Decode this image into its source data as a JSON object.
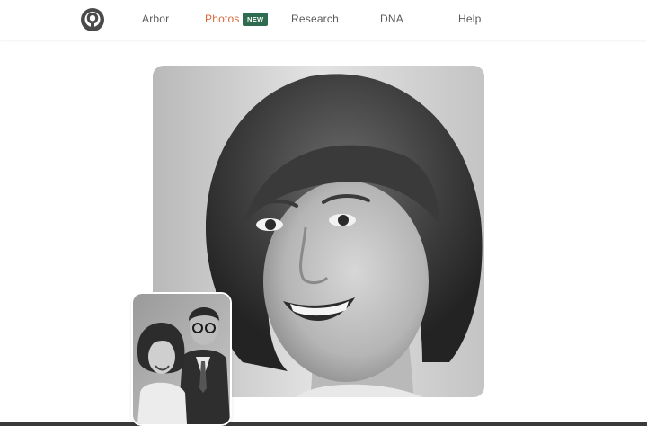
{
  "nav": {
    "items": [
      {
        "label": "Arbor"
      },
      {
        "label": "Photos",
        "active": true
      },
      {
        "label": "Research"
      },
      {
        "label": "DNA"
      },
      {
        "label": "Help"
      }
    ],
    "badge": "NEW"
  },
  "colors": {
    "active_nav": "#d6683a",
    "badge_bg": "#2f6b4f",
    "nav_text": "#5a5a5a"
  },
  "icons": {
    "logo": "tree-logo-icon"
  },
  "images": {
    "main": "restored-black-and-white-portrait-of-smiling-woman",
    "thumbnail": "original-black-and-white-couple-photo"
  }
}
